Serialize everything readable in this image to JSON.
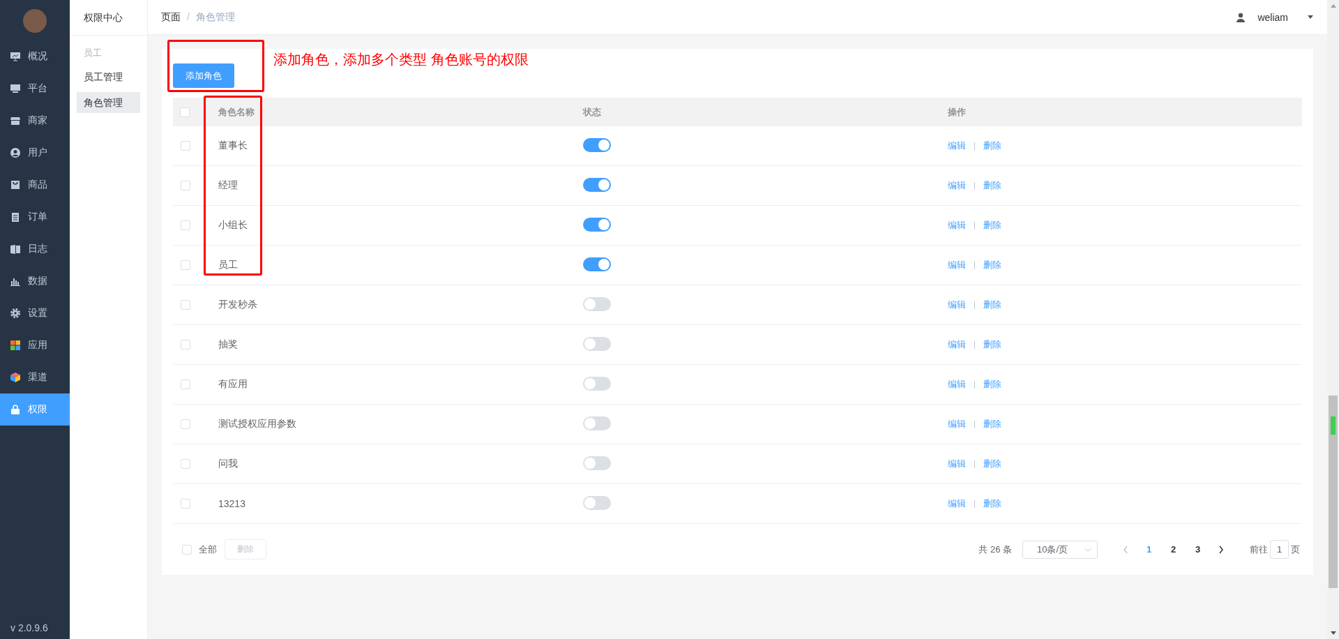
{
  "sidebar": {
    "items": [
      {
        "label": "概况",
        "selected": false
      },
      {
        "label": "平台",
        "selected": false
      },
      {
        "label": "商家",
        "selected": false
      },
      {
        "label": "用户",
        "selected": false
      },
      {
        "label": "商品",
        "selected": false
      },
      {
        "label": "订单",
        "selected": false
      },
      {
        "label": "日志",
        "selected": false
      },
      {
        "label": "数据",
        "selected": false
      },
      {
        "label": "设置",
        "selected": false
      },
      {
        "label": "应用",
        "selected": false
      },
      {
        "label": "渠道",
        "selected": false
      },
      {
        "label": "权限",
        "selected": true
      }
    ],
    "version": "v 2.0.9.6"
  },
  "subnav": {
    "title": "权限中心",
    "group": "员工",
    "items": [
      {
        "label": "员工管理",
        "selected": false
      },
      {
        "label": "角色管理",
        "selected": true
      }
    ]
  },
  "breadcrumb": {
    "items": [
      "页面",
      "角色管理"
    ],
    "separator": "/"
  },
  "user": {
    "name": "weliam"
  },
  "add_button": "添加角色",
  "annotation": "添加角色，添加多个类型 角色账号的权限",
  "table": {
    "columns": [
      "角色名称",
      "状态",
      "操作"
    ],
    "header_checked": false,
    "rows": [
      {
        "name": "董事长",
        "on": true,
        "checked": false,
        "actions": [
          "编辑",
          "删除"
        ]
      },
      {
        "name": "经理",
        "on": true,
        "checked": false,
        "actions": [
          "编辑",
          "删除"
        ]
      },
      {
        "name": "小组长",
        "on": true,
        "checked": false,
        "actions": [
          "编辑",
          "删除"
        ]
      },
      {
        "name": "员工",
        "on": true,
        "checked": false,
        "actions": [
          "编辑",
          "删除"
        ]
      },
      {
        "name": "开发秒杀",
        "on": false,
        "checked": false,
        "actions": [
          "编辑",
          "删除"
        ]
      },
      {
        "name": "抽奖",
        "on": false,
        "checked": false,
        "actions": [
          "编辑",
          "删除"
        ]
      },
      {
        "name": "有应用",
        "on": false,
        "checked": false,
        "actions": [
          "编辑",
          "删除"
        ]
      },
      {
        "name": "测试授权应用参数",
        "on": false,
        "checked": false,
        "actions": [
          "编辑",
          "删除"
        ]
      },
      {
        "name": "问我",
        "on": false,
        "checked": false,
        "actions": [
          "编辑",
          "删除"
        ]
      },
      {
        "name": "13213",
        "on": false,
        "checked": false,
        "actions": [
          "编辑",
          "删除"
        ]
      }
    ]
  },
  "footer": {
    "select_all": {
      "label": "全部",
      "checked": false
    },
    "delete_button": {
      "label": "删除",
      "disabled": true
    }
  },
  "pagination": {
    "total": "共 26 条",
    "page_size": "10条/页",
    "pages": [
      {
        "label": "1",
        "selected": true
      },
      {
        "label": "2",
        "selected": false
      },
      {
        "label": "3",
        "selected": false
      }
    ],
    "goto_label": "前往",
    "goto_value": "1",
    "goto_suffix": "页"
  }
}
